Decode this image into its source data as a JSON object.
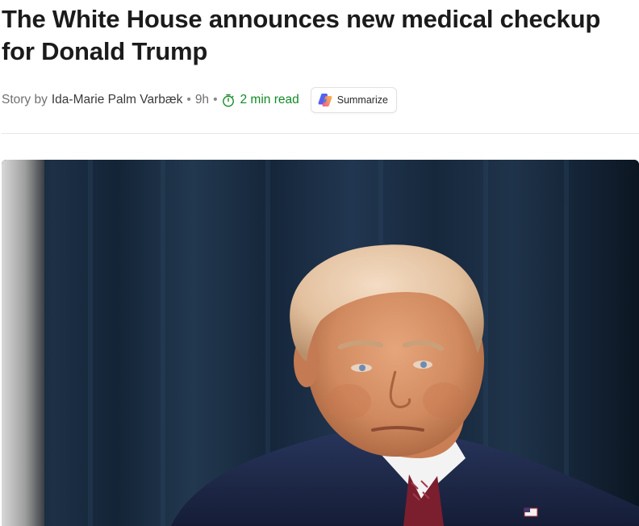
{
  "article": {
    "headline": "The White House announces new medical checkup for Donald Trump",
    "byline": {
      "prefix": "Story by",
      "author": "Ida-Marie Palm Varbæk",
      "age": "9h",
      "read_time": "2 min read"
    },
    "summarize_label": "Summarize",
    "hero_image": {
      "icon": "photo-portrait"
    }
  },
  "colors": {
    "accent_green": "#138a26",
    "text_muted": "#707070",
    "divider": "#e6e6e6"
  }
}
